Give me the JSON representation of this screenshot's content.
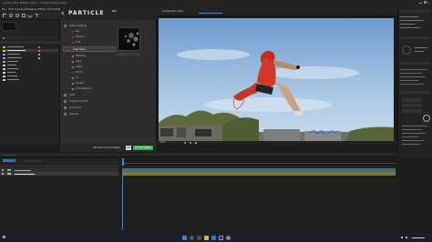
{
  "title_bar": {
    "title": "Adobe After Effects 2023 - Untitled Project.aep"
  },
  "menu": {
    "items": [
      "File",
      "Edit",
      "Composition",
      "Layer",
      "Effect",
      "Animation",
      "View",
      "Window",
      "Help"
    ]
  },
  "particle_panel": {
    "logo": "PARTICLE",
    "logo_badge": "PRO",
    "tree_items": [
      "Global Settings",
      "Set",
      "Particle",
      "Trail",
      "Inset Mode",
      "Particles",
      "Style",
      "Lights",
      "Motion",
      "Fx",
      "Advect",
      "Color Balance",
      "Glow",
      "Turbulence Field",
      "Overshoot",
      "Textures"
    ],
    "apply_button": "Apply",
    "cancel_button": "Cancel",
    "footer_text": "Get Color From Footage",
    "on_label": "ON",
    "active_label": "ACTIVE IMAGE"
  },
  "comp_panel": {
    "tab_label": "Composition: Main",
    "zoom": "50%"
  },
  "colors": {
    "accent": "#2d8ceb",
    "sky": "#a9c7e4",
    "record_red": "#d62828",
    "active_green": "#35b34a"
  },
  "icons": [
    "search-icon",
    "start-icon",
    "taskview-icon",
    "explorer-icon",
    "browser-icon",
    "ae-icon",
    "settings-icon"
  ]
}
